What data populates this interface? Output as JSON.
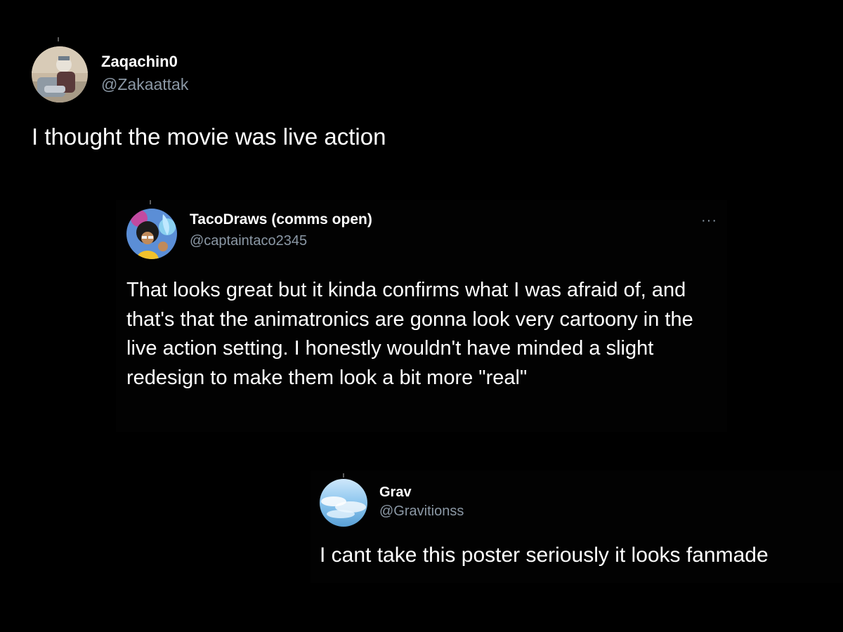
{
  "tweets": [
    {
      "display_name": "Zaqachin0",
      "handle": "@Zakaattak",
      "text": "I thought the movie was live action",
      "avatar_icon": "user-avatar-photo"
    },
    {
      "display_name": "TacoDraws (comms open)",
      "handle": "@captaintaco2345",
      "text": "That looks great but it kinda confirms what I was afraid of, and that's that the animatronics are gonna look very cartoony in the live action setting. I honestly wouldn't have minded a slight redesign to make them look a bit more \"real\"",
      "more_icon": "···",
      "avatar_icon": "user-avatar-cartoon"
    },
    {
      "display_name": "Grav",
      "handle": "@Gravitionss",
      "text": "I cant take this poster seriously it looks fanmade",
      "avatar_icon": "user-avatar-sky"
    }
  ],
  "colors": {
    "background": "#000000",
    "text_primary": "#ffffff",
    "text_secondary": "#8b98a5"
  }
}
